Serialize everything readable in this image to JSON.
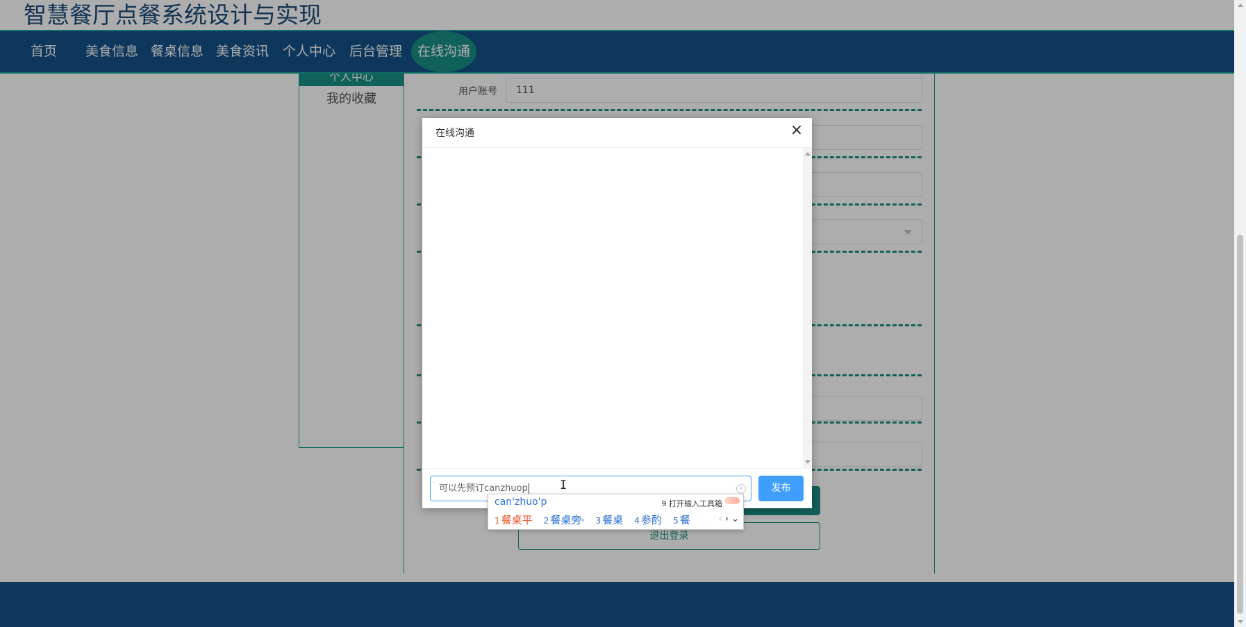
{
  "site_title": "智慧餐厅点餐系统设计与实现",
  "nav": {
    "items": [
      {
        "label": "首页"
      },
      {
        "label": "美食信息"
      },
      {
        "label": "餐桌信息"
      },
      {
        "label": "美食资讯"
      },
      {
        "label": "个人中心"
      },
      {
        "label": "后台管理"
      },
      {
        "label": "在线沟通"
      }
    ],
    "active_label": "在线沟通"
  },
  "sidebar": {
    "header_label": "个人中心",
    "items": [
      {
        "label": "我的收藏"
      }
    ]
  },
  "form": {
    "user_account_label": "用户账号",
    "user_account_value": "111"
  },
  "buttons": {
    "logout_label": "退出登录"
  },
  "dialog": {
    "title": "在线沟通",
    "close_symbol": "×",
    "input_value": "可以先预订canzhuop",
    "publish_label": "发布"
  },
  "ime": {
    "composition": "can'zhuo'p",
    "toolbox_label": "9 打开输入工具箱",
    "candidates": [
      {
        "num": "1",
        "text": "餐桌平"
      },
      {
        "num": "2",
        "text": "餐桌旁"
      },
      {
        "num": "3",
        "text": "餐桌"
      },
      {
        "num": "4",
        "text": "参酌"
      },
      {
        "num": "5",
        "text": "餐"
      }
    ]
  },
  "colors": {
    "nav_bg": "#16528a",
    "accent_teal": "#1a8f86",
    "primary_blue": "#409eff",
    "ime_selected": "#e8582d"
  }
}
